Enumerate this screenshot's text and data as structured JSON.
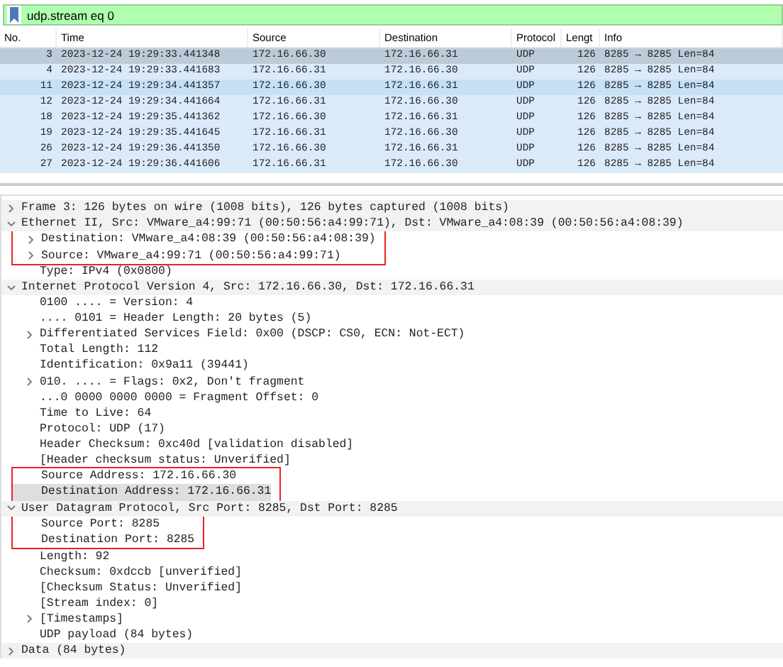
{
  "filter": {
    "value": "udp.stream eq 0"
  },
  "packet_list": {
    "columns": [
      "No.",
      "Time",
      "Source",
      "Destination",
      "Protocol",
      "Lengt",
      "Info"
    ],
    "rows": [
      {
        "cells": [
          "3",
          "2023-12-24 19:29:33.441348",
          "172.16.66.30",
          "172.16.66.31",
          "UDP",
          "126",
          "8285 → 8285 Len=84"
        ],
        "selected": true,
        "hovered": false
      },
      {
        "cells": [
          "4",
          "2023-12-24 19:29:33.441683",
          "172.16.66.31",
          "172.16.66.30",
          "UDP",
          "126",
          "8285 → 8285 Len=84"
        ],
        "selected": false,
        "hovered": false
      },
      {
        "cells": [
          "11",
          "2023-12-24 19:29:34.441357",
          "172.16.66.30",
          "172.16.66.31",
          "UDP",
          "126",
          "8285 → 8285 Len=84"
        ],
        "selected": false,
        "hovered": true
      },
      {
        "cells": [
          "12",
          "2023-12-24 19:29:34.441664",
          "172.16.66.31",
          "172.16.66.30",
          "UDP",
          "126",
          "8285 → 8285 Len=84"
        ],
        "selected": false,
        "hovered": false
      },
      {
        "cells": [
          "18",
          "2023-12-24 19:29:35.441362",
          "172.16.66.30",
          "172.16.66.31",
          "UDP",
          "126",
          "8285 → 8285 Len=84"
        ],
        "selected": false,
        "hovered": false
      },
      {
        "cells": [
          "19",
          "2023-12-24 19:29:35.441645",
          "172.16.66.31",
          "172.16.66.30",
          "UDP",
          "126",
          "8285 → 8285 Len=84"
        ],
        "selected": false,
        "hovered": false
      },
      {
        "cells": [
          "26",
          "2023-12-24 19:29:36.441350",
          "172.16.66.30",
          "172.16.66.31",
          "UDP",
          "126",
          "8285 → 8285 Len=84"
        ],
        "selected": false,
        "hovered": false
      },
      {
        "cells": [
          "27",
          "2023-12-24 19:29:36.441606",
          "172.16.66.31",
          "172.16.66.30",
          "UDP",
          "126",
          "8285 → 8285 Len=84"
        ],
        "selected": false,
        "hovered": false
      }
    ]
  },
  "details": [
    {
      "text": "Frame 3: 126 bytes on wire (1008 bits), 126 bytes captured (1008 bits)",
      "expanded": false,
      "selected": false,
      "boxed": false
    },
    {
      "text": "Ethernet II, Src: VMware_a4:99:71 (00:50:56:a4:99:71), Dst: VMware_a4:08:39 (00:50:56:a4:08:39)",
      "expanded": true,
      "selected": false,
      "boxed": false,
      "children": [
        {
          "text": "Destination: VMware_a4:08:39 (00:50:56:a4:08:39)",
          "expanded": false,
          "selected": false,
          "boxed": true
        },
        {
          "text": "Source: VMware_a4:99:71 (00:50:56:a4:99:71)",
          "expanded": false,
          "selected": false,
          "boxed": true
        },
        {
          "text": "Type: IPv4 (0x0800)",
          "selected": false,
          "boxed": false
        }
      ]
    },
    {
      "text": "Internet Protocol Version 4, Src: 172.16.66.30, Dst: 172.16.66.31",
      "expanded": true,
      "selected": false,
      "boxed": false,
      "children": [
        {
          "text": "0100 .... = Version: 4",
          "selected": false,
          "boxed": false
        },
        {
          "text": ".... 0101 = Header Length: 20 bytes (5)",
          "selected": false,
          "boxed": false
        },
        {
          "text": "Differentiated Services Field: 0x00 (DSCP: CS0, ECN: Not-ECT)",
          "expanded": false,
          "selected": false,
          "boxed": false
        },
        {
          "text": "Total Length: 112",
          "selected": false,
          "boxed": false
        },
        {
          "text": "Identification: 0x9a11 (39441)",
          "selected": false,
          "boxed": false
        },
        {
          "text": "010. .... = Flags: 0x2, Don't fragment",
          "expanded": false,
          "selected": false,
          "boxed": false
        },
        {
          "text": "...0 0000 0000 0000 = Fragment Offset: 0",
          "selected": false,
          "boxed": false
        },
        {
          "text": "Time to Live: 64",
          "selected": false,
          "boxed": false
        },
        {
          "text": "Protocol: UDP (17)",
          "selected": false,
          "boxed": false
        },
        {
          "text": "Header Checksum: 0xc40d [validation disabled]",
          "selected": false,
          "boxed": false
        },
        {
          "text": "[Header checksum status: Unverified]",
          "selected": false,
          "boxed": false
        },
        {
          "text": "Source Address: 172.16.66.30",
          "selected": false,
          "boxed": true
        },
        {
          "text": "Destination Address: 172.16.66.31",
          "selected": true,
          "boxed": true
        }
      ]
    },
    {
      "text": "User Datagram Protocol, Src Port: 8285, Dst Port: 8285",
      "expanded": true,
      "selected": false,
      "boxed": false,
      "children": [
        {
          "text": "Source Port: 8285",
          "selected": false,
          "boxed": true
        },
        {
          "text": "Destination Port: 8285",
          "selected": false,
          "boxed": true
        },
        {
          "text": "Length: 92",
          "selected": false,
          "boxed": false
        },
        {
          "text": "Checksum: 0xdccb [unverified]",
          "selected": false,
          "boxed": false
        },
        {
          "text": "[Checksum Status: Unverified]",
          "selected": false,
          "boxed": false
        },
        {
          "text": "[Stream index: 0]",
          "selected": false,
          "boxed": false
        },
        {
          "text": "[Timestamps]",
          "expanded": false,
          "selected": false,
          "boxed": false
        },
        {
          "text": "UDP payload (84 bytes)",
          "selected": false,
          "boxed": false
        }
      ]
    },
    {
      "text": "Data (84 bytes)",
      "expanded": false,
      "selected": false,
      "boxed": false
    }
  ]
}
